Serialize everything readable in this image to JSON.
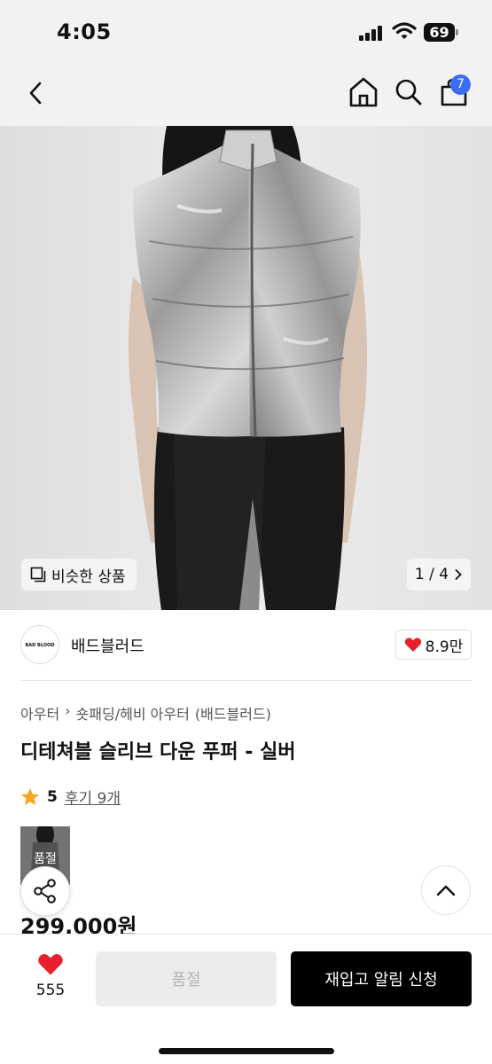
{
  "status_bar": {
    "time": "4:05",
    "battery": "69"
  },
  "nav": {
    "cart_count": "7"
  },
  "gallery": {
    "similar_label": "비슷한 상품",
    "page_indicator": "1 / 4"
  },
  "brand": {
    "name": "배드블러드",
    "logo_text": "BAD BLOOD",
    "like_count": "8.9만"
  },
  "breadcrumb": {
    "level1": "아우터",
    "level2": "숏패딩/헤비 아우터",
    "brand_tag": "(배드블러드)"
  },
  "product": {
    "title": "디테쳐블 슬리브 다운 푸퍼 - 실버",
    "rating": "5",
    "reviews": "후기 9개",
    "thumb_label": "품절",
    "price": "299,000원"
  },
  "bottom_bar": {
    "like_count": "555",
    "soldout_label": "품절",
    "restock_label": "재입고 알림 신청"
  },
  "colors": {
    "accent_badge": "#3b6cf6",
    "heart": "#e8202d",
    "star": "#f5a623",
    "primary_button": "#000000"
  },
  "icons": [
    "back-icon",
    "home-icon",
    "search-icon",
    "cart-icon",
    "similar-icon",
    "chevron-right-icon",
    "heart-icon",
    "star-icon",
    "share-icon",
    "chevron-up-icon"
  ]
}
